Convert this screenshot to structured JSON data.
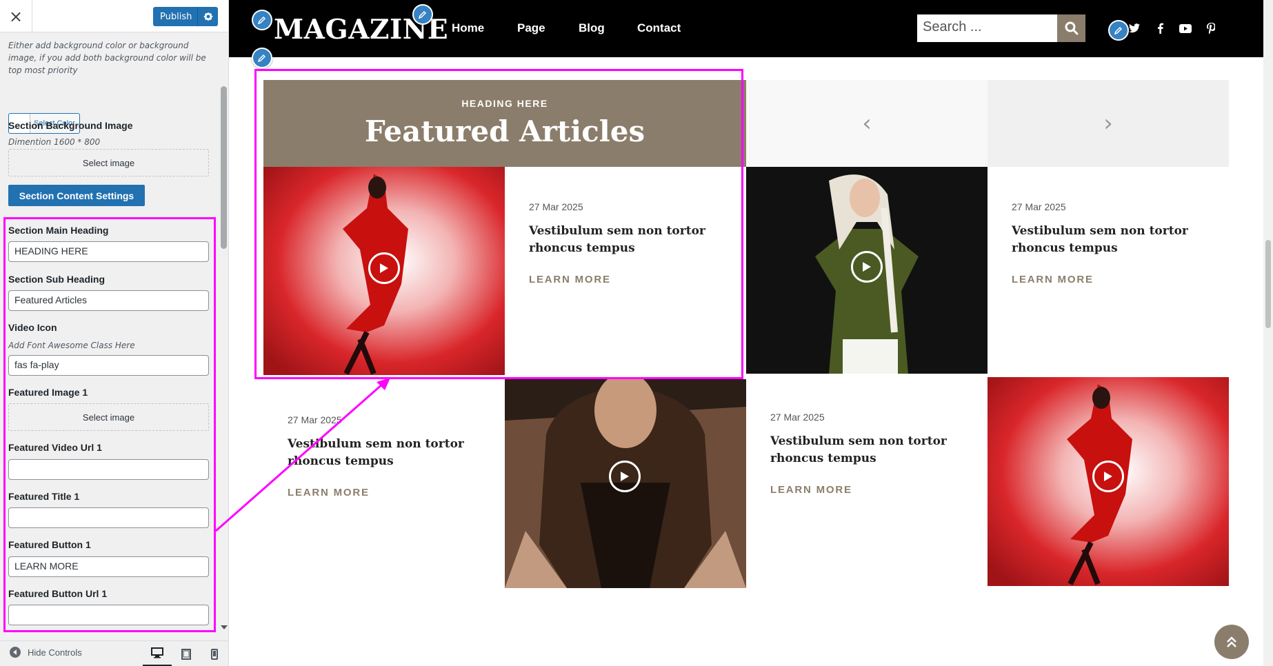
{
  "sidebar": {
    "close_label": "×",
    "publish_label": "Publish",
    "bg_description": "Either add background color or background image, if you add both background color will be top most priority",
    "select_color_label": "Select Color",
    "bg_image_label": "Section Background Image",
    "bg_image_dimension": "Dimention 1600 * 800",
    "select_image_label": "Select image",
    "section_content_settings": "Section Content Settings",
    "fields": {
      "main_heading": {
        "label": "Section Main Heading",
        "value": "HEADING HERE"
      },
      "sub_heading": {
        "label": "Section Sub Heading",
        "value": "Featured Articles"
      },
      "video_icon": {
        "label": "Video Icon",
        "hint": "Add Font Awesome Class Here",
        "value": "fas fa-play"
      },
      "featured_image_1": {
        "label": "Featured Image 1",
        "button": "Select image"
      },
      "featured_video_url_1": {
        "label": "Featured Video Url 1",
        "value": ""
      },
      "featured_title_1": {
        "label": "Featured Title 1",
        "value": ""
      },
      "featured_button_1": {
        "label": "Featured Button 1",
        "value": "LEARN MORE"
      },
      "featured_button_url_1": {
        "label": "Featured Button Url 1",
        "value": ""
      }
    },
    "footer": {
      "hide_controls": "Hide Controls"
    }
  },
  "site": {
    "logo": "MAGAZINE",
    "nav": [
      "Home",
      "Page",
      "Blog",
      "Contact"
    ],
    "search_placeholder": "Search ...",
    "social_icons": [
      "twitter-icon",
      "facebook-icon",
      "youtube-icon",
      "pinterest-icon"
    ]
  },
  "featured": {
    "heading_small": "HEADING HERE",
    "heading_big": "Featured Articles",
    "prev_label": "‹",
    "next_label": "›",
    "articles": [
      {
        "date": "27 Mar 2025",
        "title": "Vestibulum sem non tortor rhoncus tempus",
        "button": "LEARN MORE"
      },
      {
        "date": "27 Mar 2025",
        "title": "Vestibulum sem non tortor rhoncus tempus",
        "button": "LEARN MORE"
      },
      {
        "date": "27 Mar 2025",
        "title": "Vestibulum sem non tortor rhoncus tempus",
        "button": "LEARN MORE"
      },
      {
        "date": "27 Mar 2025",
        "title": "Vestibulum sem non tortor rhoncus tempus",
        "button": "LEARN MORE"
      }
    ]
  },
  "colors": {
    "accent": "#8b7d6b",
    "wp_blue": "#2271b1",
    "highlight": "#ff00ff",
    "header_bg": "#000000"
  }
}
